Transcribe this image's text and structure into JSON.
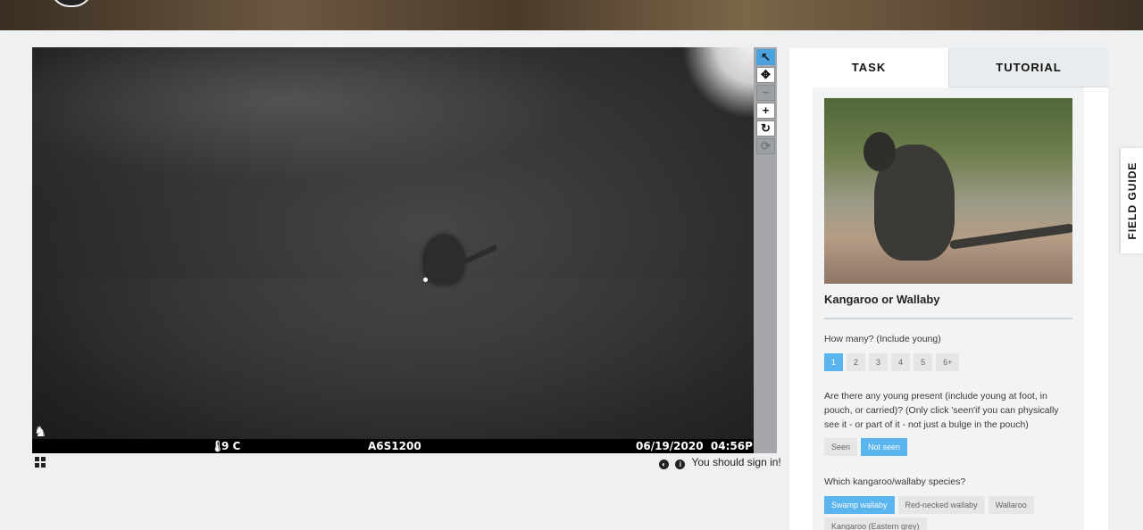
{
  "subject": {
    "camera_temp": "9 C",
    "camera_model": "A6S1200",
    "camera_datetime": "06/19/2020  04:56PM",
    "sign_in_notice": "You should sign in!"
  },
  "toolbar": {
    "tools": [
      {
        "name": "pointer-tool",
        "icon": "↖",
        "state": "active"
      },
      {
        "name": "move-tool",
        "icon": "✥",
        "state": "normal"
      },
      {
        "name": "zoom-out-tool",
        "icon": "−",
        "state": "disabled"
      },
      {
        "name": "zoom-in-tool",
        "icon": "+",
        "state": "normal"
      },
      {
        "name": "rotate-tool",
        "icon": "↻",
        "state": "normal"
      },
      {
        "name": "reset-tool",
        "icon": "⟳",
        "state": "disabled"
      }
    ]
  },
  "tabs": {
    "task": "TASK",
    "tutorial": "TUTORIAL"
  },
  "task": {
    "species": "Kangaroo or Wallaby",
    "questions": [
      {
        "text": "How many? (Include young)",
        "options": [
          "1",
          "2",
          "3",
          "4",
          "5",
          "6+"
        ],
        "selected": "1"
      },
      {
        "text": "Are there any young present (include young at foot, in pouch, or carried)? (Only click 'seen'if you can physically see it - or part of it - not just a bulge in the pouch)",
        "options": [
          "Seen",
          "Not seen"
        ],
        "selected": "Not seen"
      },
      {
        "text": "Which kangaroo/wallaby species?",
        "options": [
          "Swamp wallaby",
          "Red-necked wallaby",
          "Wallaroo",
          "Kangaroo (Eastern grey)"
        ],
        "selected": "Swamp wallaby"
      }
    ]
  },
  "field_guide": "FIELD GUIDE",
  "colors": {
    "accent": "#5ab4ee",
    "active_tool": "#4aa3df"
  }
}
